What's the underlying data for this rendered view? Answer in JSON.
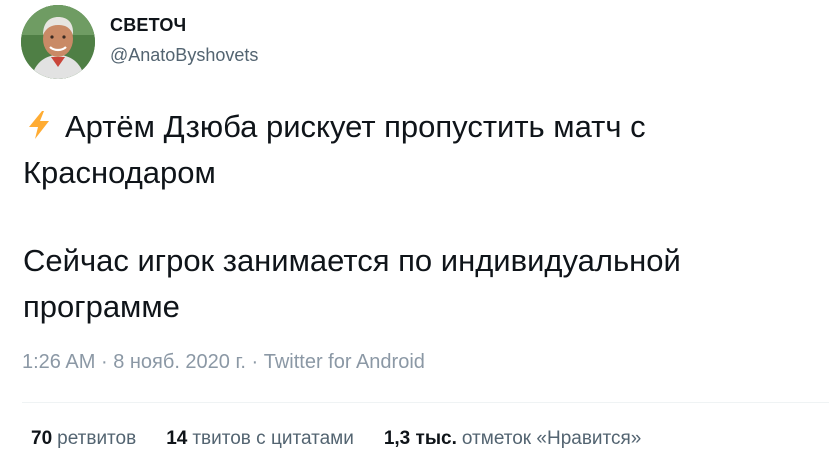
{
  "author": {
    "display_name": "СВЕТОЧ",
    "handle": "@AnatoByshovets"
  },
  "tweet": {
    "emoji_icon": "lightning-bolt-icon",
    "paragraph_1": "Артём Дзюба рискует пропустить матч с Краснодаром",
    "paragraph_2": "Сейчас игрок занимается по индивидуальной программе"
  },
  "meta": {
    "time": "1:26 AM",
    "separator": "·",
    "date": "8 нояб. 2020 г.",
    "source": "Twitter for Android"
  },
  "stats": {
    "retweets_count": "70",
    "retweets_label": "ретвитов",
    "quotes_count": "14",
    "quotes_label": "твитов с цитатами",
    "likes_count": "1,3 тыс.",
    "likes_label": "отметок «Нравится»"
  },
  "colors": {
    "text": "#0f1419",
    "secondary": "#536471",
    "meta": "#8b98a5",
    "divider": "#eff3f4",
    "bolt": "#ffac33"
  }
}
